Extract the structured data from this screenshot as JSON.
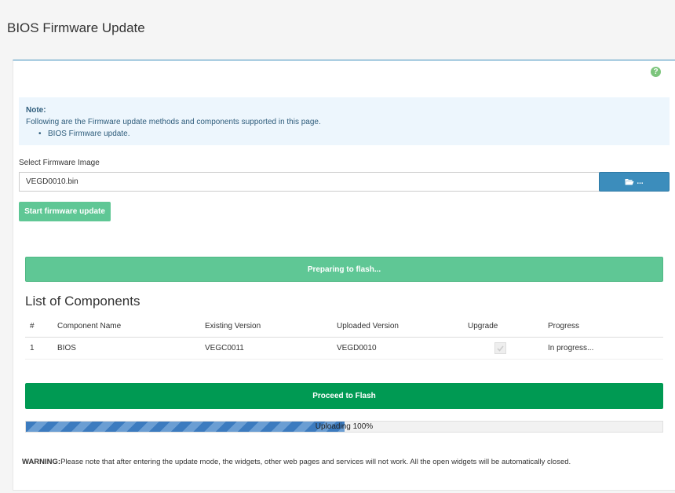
{
  "page": {
    "title": "BIOS Firmware Update"
  },
  "help": {
    "icon": "help-circle-icon",
    "glyph": "?"
  },
  "note": {
    "title": "Note:",
    "text": "Following are the Firmware update methods and components supported in this page.",
    "items": [
      "BIOS Firmware update."
    ]
  },
  "firmware": {
    "select_label": "Select Firmware Image",
    "file_value": "VEGD0010.bin",
    "browse_label": "...",
    "browse_icon": "folder-open-icon",
    "start_label": "Start firmware update"
  },
  "status": {
    "preparing": "Preparing to flash..."
  },
  "components": {
    "title": "List of Components",
    "headers": {
      "num": "#",
      "name": "Component Name",
      "existing": "Existing Version",
      "uploaded": "Uploaded Version",
      "upgrade": "Upgrade",
      "progress": "Progress"
    },
    "rows": [
      {
        "num": "1",
        "name": "BIOS",
        "existing": "VEGC0011",
        "uploaded": "VEGD0010",
        "upgrade": true,
        "progress": "In progress..."
      }
    ]
  },
  "flash": {
    "label": "Proceed to Flash"
  },
  "upload": {
    "label": "Uploading 100%",
    "fill_fraction": 0.5
  },
  "warning": {
    "label": "WARNING:",
    "text": "Please note that after entering the update mode, the widgets, other web pages and services will not work. All the open widgets will be automatically closed."
  },
  "colors": {
    "accent": "#3c8dbc",
    "success": "#5fc795",
    "flash": "#009a53",
    "note_bg": "#edf6fd"
  }
}
